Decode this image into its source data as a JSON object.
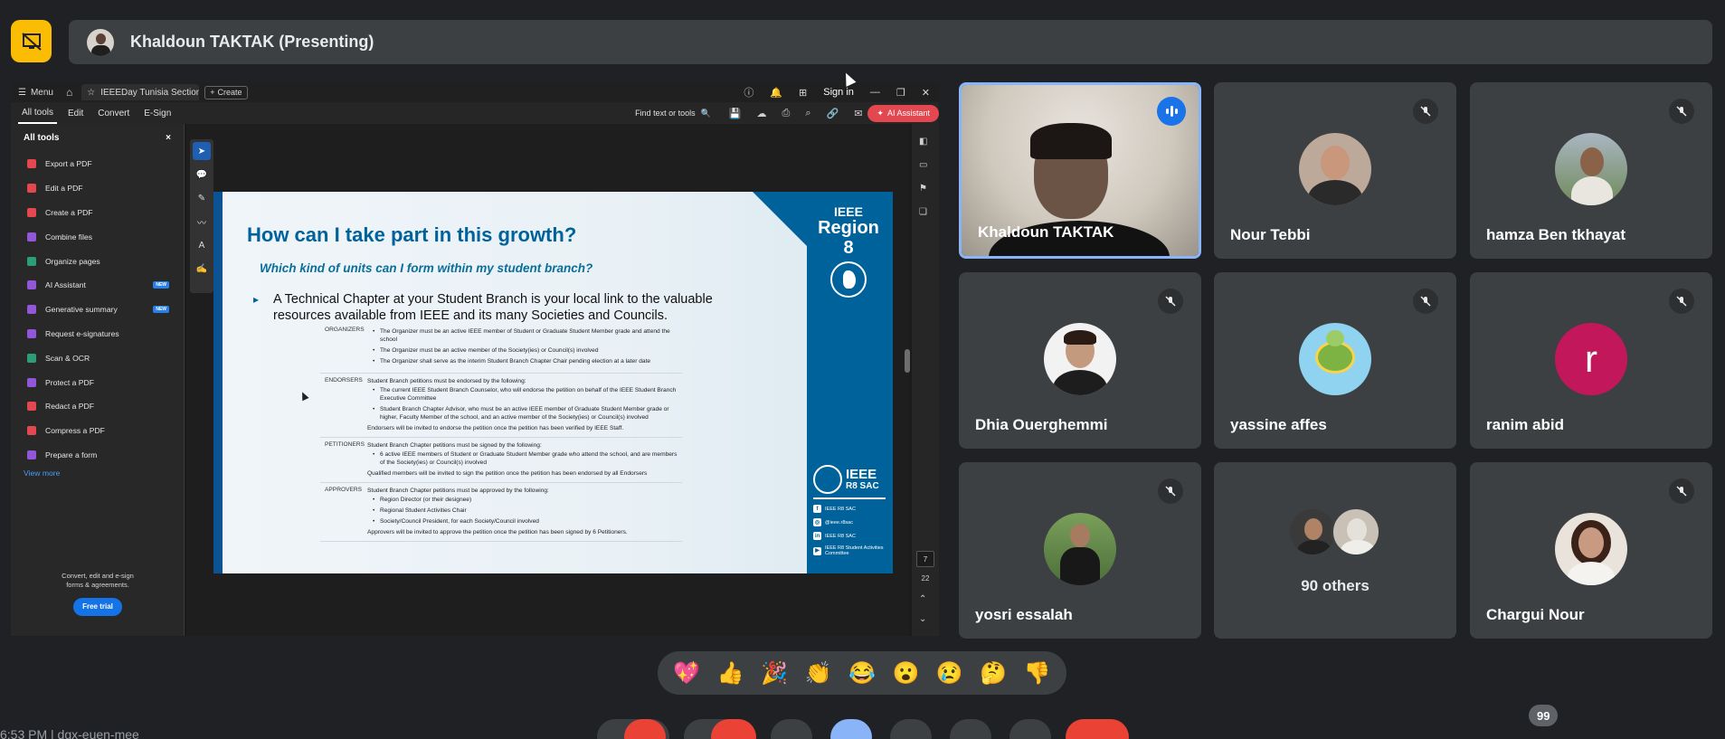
{
  "presenter": {
    "name": "Khaldoun TAKTAK (Presenting)"
  },
  "acrobat": {
    "menu_label": "Menu",
    "tab_label": "IEEEDay Tunisia Section...",
    "create_label": "Create",
    "sign_in": "Sign in",
    "menubar": [
      "All tools",
      "Edit",
      "Convert",
      "E-Sign"
    ],
    "find_placeholder": "Find text or tools",
    "ai_assistant": "AI Assistant",
    "sidebar": {
      "title": "All tools",
      "items": [
        {
          "label": "Export a PDF",
          "color": "#e34850",
          "new": ""
        },
        {
          "label": "Edit a PDF",
          "color": "#e34850",
          "new": ""
        },
        {
          "label": "Create a PDF",
          "color": "#e34850",
          "new": ""
        },
        {
          "label": "Combine files",
          "color": "#9256d9",
          "new": ""
        },
        {
          "label": "Organize pages",
          "color": "#2d9d78",
          "new": ""
        },
        {
          "label": "AI Assistant",
          "color": "#9256d9",
          "new": "NEW"
        },
        {
          "label": "Generative summary",
          "color": "#9256d9",
          "new": "NEW"
        },
        {
          "label": "Request e-signatures",
          "color": "#9256d9",
          "new": ""
        },
        {
          "label": "Scan & OCR",
          "color": "#2d9d78",
          "new": ""
        },
        {
          "label": "Protect a PDF",
          "color": "#9256d9",
          "new": ""
        },
        {
          "label": "Redact a PDF",
          "color": "#e34850",
          "new": ""
        },
        {
          "label": "Compress a PDF",
          "color": "#e34850",
          "new": ""
        },
        {
          "label": "Prepare a form",
          "color": "#9256d9",
          "new": ""
        }
      ],
      "view_more": "View more",
      "promo_line1": "Convert, edit and e-sign",
      "promo_line2": "forms & agreements.",
      "free_trial": "Free trial"
    },
    "page_current": "7",
    "page_total": "22"
  },
  "slide": {
    "title": "How can I take part in this growth?",
    "subtitle": "Which kind of units can I form within my student branch?",
    "bullet": "A Technical Chapter at your Student Branch is your local link to the valuable resources available from IEEE and its many Societies and Councils.",
    "logo_line1": "IEEE",
    "logo_line2": "Region 8",
    "sac_line1": "IEEE",
    "sac_line2": "R8 SAC",
    "sac_links": [
      "IEEE R8 SAC",
      "@ieee.r8sac",
      "IEEE R8 SAC",
      "IEEE R8 Student Activities Committee"
    ],
    "table": [
      {
        "key": "ORGANIZERS",
        "intro": "",
        "items": [
          "The Organizer must be an active IEEE member of Student or Graduate Student Member grade and attend the school",
          "The Organizer must be an active member of the Society(ies) or Council(s) involved",
          "The Organizer shall serve as the interim Student Branch Chapter Chair pending election at a later date"
        ],
        "outro": ""
      },
      {
        "key": "ENDORSERS",
        "intro": "Student Branch petitions must be endorsed by the following:",
        "items": [
          "The current IEEE Student Branch Counselor, who will endorse the petition on behalf of the IEEE Student Branch Executive Committee",
          "Student Branch Chapter Advisor, who must be an active IEEE member of Graduate Student Member grade or higher, Faculty Member of the school, and an active member of the Society(ies) or Council(s) involved"
        ],
        "outro": "Endorsers will be invited to endorse the petition once the petition has been verified by IEEE Staff."
      },
      {
        "key": "PETITIONERS",
        "intro": "Student Branch Chapter petitions must be signed by the following:",
        "items": [
          "6 active IEEE members of Student or Graduate Student Member grade who attend the school, and are members of the Society(ies) or Council(s) involved"
        ],
        "outro": "Qualified members will be invited to sign the petition once the petition has been endorsed by all Endorsers"
      },
      {
        "key": "APPROVERS",
        "intro": "Student Branch Chapter petitions must be approved by the following:",
        "items": [
          "Region Director (or their designee)",
          "Regional Student Activities Chair",
          "Society/Council President, for each Society/Council involved"
        ],
        "outro": "Approvers will be invited to approve the petition once the petition has been signed by 6 Petitioners."
      }
    ]
  },
  "participants": [
    {
      "name": "Khaldoun TAKTAK"
    },
    {
      "name": "Nour Tebbi"
    },
    {
      "name": "hamza Ben tkhayat"
    },
    {
      "name": "Dhia Ouerghemmi"
    },
    {
      "name": "yassine affes"
    },
    {
      "name": "ranim abid",
      "initial": "r"
    },
    {
      "name": "yosri essalah"
    },
    {
      "name": "90 others"
    },
    {
      "name": "Chargui Nour"
    }
  ],
  "reactions": [
    "💖",
    "👍",
    "🎉",
    "👏",
    "😂",
    "😮",
    "😢",
    "🤔",
    "👎"
  ],
  "bottom": {
    "clock": "6:53 PM | dgx-euen-mee",
    "hand_badge": "99"
  },
  "colors": {
    "accent_yellow": "#fbbc04",
    "speaking_blue": "#8ab4f8",
    "end_call_red": "#ea4335",
    "ieee_blue": "#00629b"
  }
}
